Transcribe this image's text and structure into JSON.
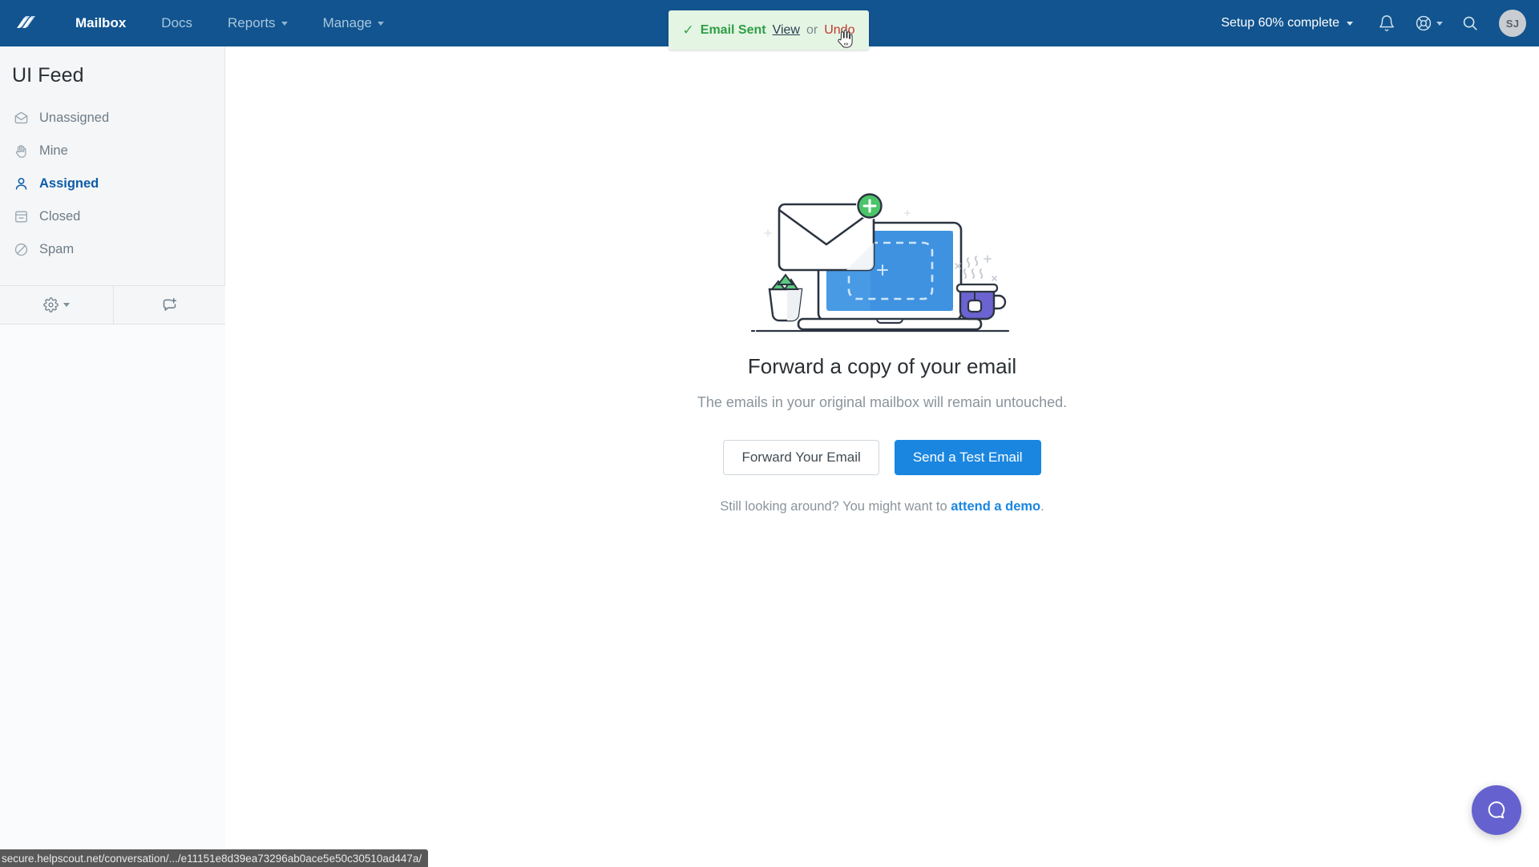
{
  "header": {
    "logo_icon": "helpscout-logo-icon",
    "nav": [
      {
        "label": "Mailbox",
        "active": true,
        "has_caret": false
      },
      {
        "label": "Docs",
        "active": false,
        "has_caret": false
      },
      {
        "label": "Reports",
        "active": false,
        "has_caret": true
      },
      {
        "label": "Manage",
        "active": false,
        "has_caret": true
      }
    ],
    "setup_status": "Setup 60% complete",
    "notifications_icon": "bell-icon",
    "help_icon": "lifebuoy-icon",
    "search_icon": "search-icon",
    "avatar_initials": "SJ",
    "bg_color": "#11548f"
  },
  "toast": {
    "check_icon": "check-icon",
    "message": "Email Sent",
    "view_label": "View",
    "or_label": "or",
    "undo_label": "Undo",
    "bg_color": "#e4f5e4",
    "success_color": "#2e9e46",
    "undo_color": "#c0392b"
  },
  "sidebar": {
    "title": "UI Feed",
    "items": [
      {
        "label": "Unassigned",
        "icon": "envelope-open-icon",
        "active": false
      },
      {
        "label": "Mine",
        "icon": "hand-icon",
        "active": false
      },
      {
        "label": "Assigned",
        "icon": "user-icon",
        "active": true
      },
      {
        "label": "Closed",
        "icon": "archive-icon",
        "active": false
      },
      {
        "label": "Spam",
        "icon": "ban-icon",
        "active": false
      }
    ],
    "tools": [
      {
        "name": "settings",
        "icon": "gear-icon",
        "has_caret": true
      },
      {
        "name": "new-conversation",
        "icon": "new-conversation-icon",
        "has_caret": false
      }
    ],
    "active_color": "#0d5ca8"
  },
  "main": {
    "illustration": "laptop-envelope-illustration",
    "title": "Forward a copy of your email",
    "subtitle": "The emails in your original mailbox will remain untouched.",
    "secondary_button": "Forward Your Email",
    "primary_button": "Send a Test Email",
    "demo_prefix": "Still looking around? You might want to ",
    "demo_link": "attend a demo",
    "demo_suffix": ".",
    "primary_color": "#1a86e0"
  },
  "beacon": {
    "icon": "chat-bubble-icon",
    "color": "#6562cf"
  },
  "statusbar": {
    "url": "secure.helpscout.net/conversation/.../e11151e8d39ea73296ab0ace5e50c30510ad447a/"
  },
  "cursor": {
    "icon": "pointing-hand-cursor"
  }
}
